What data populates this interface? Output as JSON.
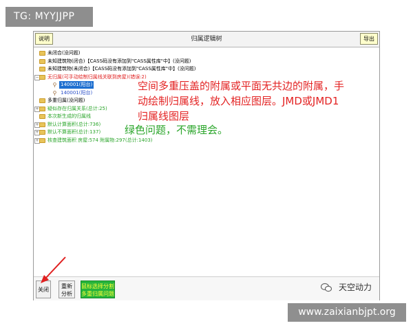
{
  "tag": "TG: MYYJJPP",
  "window": {
    "title": "归属逻辑树",
    "left_button": "说明",
    "right_button": "导出"
  },
  "tree": [
    {
      "label": "未闭合(没问题)",
      "color": "#333333"
    },
    {
      "label": "未知建筑物(闭合)【CASS码没有添加到\"CASS属性库\"中】(没问题)",
      "color": "#333333"
    },
    {
      "label": "未知建筑物(未闭合)【CASS码没有添加到\"CASS属性库\"中】(没问题)",
      "color": "#333333"
    },
    {
      "label": "无归属(可手动绘制归属线关联到房屋)(错误:2)",
      "color": "#e02020"
    },
    {
      "label": "140001(阳台)",
      "color": "#ffffff"
    },
    {
      "label": "140001(阳台)",
      "color": "#2b4fc8"
    },
    {
      "label": "多重归属(没问题)",
      "color": "#333333"
    },
    {
      "label": "疑似存在归属关系(总计:25)",
      "color": "#2aa52a"
    },
    {
      "label": "本次新生成的归属线",
      "color": "#2aa52a"
    },
    {
      "label": "默认计算面积(总计:736)",
      "color": "#2aa52a"
    },
    {
      "label": "默认不算面积(总计:137)",
      "color": "#2aa52a"
    },
    {
      "label": "核查建筑面积 房屋:574 附属物:297(总计:1403)",
      "color": "#2aa52a"
    }
  ],
  "annotation": {
    "line1": "空间多重压盖的附属或平面无共边的附属，手",
    "line2": "动绘制归属线，放入相应图层。JMD或JMD1",
    "line3": "归属线图层",
    "green_note": "绿色问题，不需理会。"
  },
  "bottom": {
    "close": "关闭",
    "reanalyze_line1": "重新",
    "reanalyze_line2": "分析",
    "split_line1": "鼠标选择分割",
    "split_line2": "多重归属问题"
  },
  "wechat_label": "天空动力",
  "watermark": "www.zaixianbjpt.org",
  "colors": {
    "error_red": "#e02020",
    "ok_green": "#2aa52a",
    "selection_blue": "#1e6fd0",
    "split_button_green": "#26b43c"
  }
}
